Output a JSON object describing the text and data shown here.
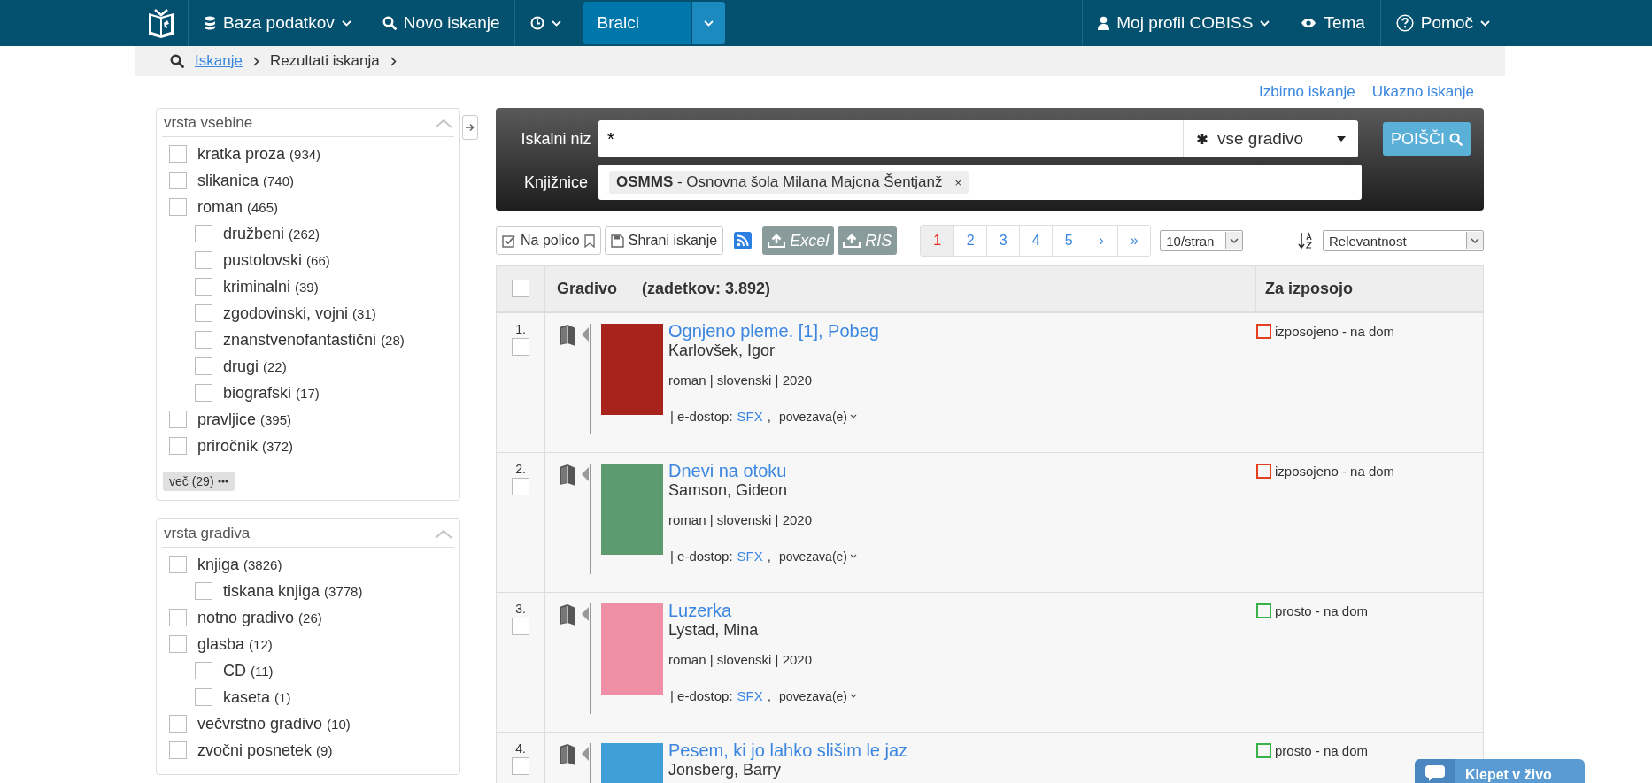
{
  "nav": {
    "left": [
      {
        "kind": "menu",
        "label": "Baza podatkov"
      },
      {
        "kind": "link",
        "label": "Novo iskanje"
      },
      {
        "kind": "menu"
      }
    ],
    "segment": {
      "label": "Bralci"
    },
    "right": [
      {
        "kind": "menu",
        "label": "Moj profil COBISS"
      },
      {
        "kind": "link",
        "label": "Tema"
      },
      {
        "kind": "menu",
        "label": "Pomoč"
      }
    ]
  },
  "breadcrumb": [
    {
      "label": "Iskanje",
      "link": true
    },
    {
      "label": "Rezultati iskanja",
      "link": false
    }
  ],
  "top_links": [
    "Izbirno iskanje",
    "Ukazno iskanje"
  ],
  "facets": [
    {
      "title": "vrsta vsebine",
      "expanded": true,
      "items": [
        {
          "label": "kratka proza",
          "count": "(934)",
          "checked": false
        },
        {
          "label": "slikanica",
          "count": "(740)",
          "checked": false
        },
        {
          "label": "roman",
          "count": "(465)",
          "checked": false,
          "children": [
            {
              "label": "družbeni",
              "count": "(262)",
              "checked": false
            },
            {
              "label": "pustolovski",
              "count": "(66)",
              "checked": false
            },
            {
              "label": "kriminalni",
              "count": "(39)",
              "checked": false
            },
            {
              "label": "zgodovinski, vojni",
              "count": "(31)",
              "checked": false
            },
            {
              "label": "znanstvenofantastični",
              "count": "(28)",
              "checked": false
            },
            {
              "label": "drugi",
              "count": "(22)",
              "checked": false
            },
            {
              "label": "biografski",
              "count": "(17)",
              "checked": false
            }
          ]
        },
        {
          "label": "pravljice",
          "count": "(395)",
          "checked": false
        },
        {
          "label": "priročnik",
          "count": "(372)",
          "checked": false
        }
      ],
      "more": "več (29)"
    },
    {
      "title": "vrsta gradiva",
      "expanded": true,
      "items": [
        {
          "label": "knjiga",
          "count": "(3826)",
          "checked": false,
          "children": [
            {
              "label": "tiskana knjiga",
              "count": "(3778)",
              "checked": false
            }
          ]
        },
        {
          "label": "notno gradivo",
          "count": "(26)",
          "checked": false
        },
        {
          "label": "glasba",
          "count": "(12)",
          "checked": false,
          "children": [
            {
              "label": "CD",
              "count": "(11)",
              "checked": false
            },
            {
              "label": "kaseta",
              "count": "(1)",
              "checked": false
            }
          ]
        },
        {
          "label": "večvrstno gradivo",
          "count": "(10)",
          "checked": false
        },
        {
          "label": "zvočni posnetek",
          "count": "(9)",
          "checked": false
        }
      ]
    }
  ],
  "search": {
    "label": "Iskalni niz",
    "value": "*",
    "material": "vse gradivo",
    "button": "POIŠČI",
    "libraries_label": "Knjižnice",
    "library": {
      "code": "OSMMS",
      "name": " - Osnovna šola Milana Majcna Šentjanž",
      "remove": "×"
    }
  },
  "toolbar": {
    "shelf": "Na polico",
    "save": "Shrani iskanje",
    "excel": "Excel",
    "ris": "RIS"
  },
  "pagination": [
    {
      "label": "1",
      "selected": true
    },
    {
      "label": "2",
      "selected": false
    },
    {
      "label": "3",
      "selected": false
    },
    {
      "label": "4",
      "selected": false
    },
    {
      "label": "5",
      "selected": false
    },
    {
      "label": "›",
      "selected": false
    },
    {
      "label": "»",
      "selected": false
    }
  ],
  "per_page": "10/stran",
  "sort": "Relevantnost",
  "table": {
    "select_all_checked": false,
    "column_material": "Gradivo",
    "hits": "(zadetkov: 3.892)",
    "column_loan": "Za izposojo"
  },
  "results": [
    {
      "number": "1.",
      "checked": false,
      "title": "Ognjeno pleme. [1], Pobeg",
      "author": "Karlovšek, Igor",
      "meta": "roman | slovenski | 2020",
      "access_label": "| e-dostop:",
      "access_link": "SFX",
      "separator": ",",
      "links": "povezava(e)",
      "availability": {
        "color": "#e5401d",
        "label": "izposojeno - na dom"
      }
    },
    {
      "number": "2.",
      "checked": false,
      "title": "Dnevi na otoku",
      "author": "Samson, Gideon",
      "meta": "roman | slovenski | 2020",
      "access_label": "| e-dostop:",
      "access_link": "SFX",
      "separator": ",",
      "links": "povezava(e)",
      "availability": {
        "color": "#e5401d",
        "label": "izposojeno - na dom"
      }
    },
    {
      "number": "3.",
      "checked": false,
      "title": "Luzerka",
      "author": "Lystad, Mina",
      "meta": "roman | slovenski | 2020",
      "access_label": "| e-dostop:",
      "access_link": "SFX",
      "separator": ",",
      "links": "povezava(e)",
      "availability": {
        "color": "#37b34a",
        "label": "prosto - na dom"
      }
    },
    {
      "number": "4.",
      "checked": false,
      "title": "Pesem, ki jo lahko slišim le jaz",
      "author": "Jonsberg, Barry",
      "availability": {
        "color": "#37b34a",
        "label": "prosto - na dom"
      }
    }
  ],
  "chat": {
    "label": "Klepet v živo"
  }
}
